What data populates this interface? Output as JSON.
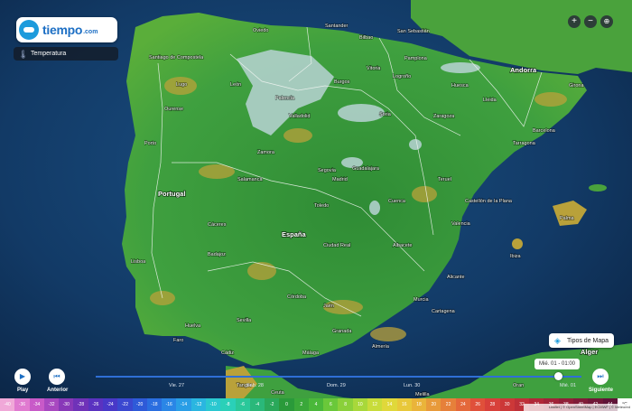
{
  "app": {
    "logo_text": "tiempo",
    "logo_domain": ".com"
  },
  "layer": {
    "label": "Temperatura",
    "icon": "thermometer-icon"
  },
  "zoom_controls": {
    "zoom_in": "+",
    "zoom_out": "−",
    "globe": "globe-icon"
  },
  "map_types": {
    "label": "Tipos de Mapa",
    "icon": "layers-icon"
  },
  "countries": {
    "portugal": "Portugal",
    "espana": "España",
    "andorra": "Andorra",
    "alger": "Alger"
  },
  "cities": [
    "Santander",
    "Bilbao",
    "San Sebastián",
    "Santiago de Compostela",
    "Oviedo",
    "Pamplona",
    "Vitoria",
    "Lugo",
    "León",
    "Burgos",
    "Logroño",
    "Huesca",
    "Lleida",
    "Girona",
    "Ourense",
    "Palencia",
    "Valladolid",
    "Soria",
    "Zaragoza",
    "Barcelona",
    "Tarragona",
    "Porto",
    "Zamora",
    "Salamanca",
    "Segovia",
    "Guadalajara",
    "Madrid",
    "Teruel",
    "Castellón de la Plana",
    "Toledo",
    "Cuenca",
    "Valencia",
    "Palma",
    "Ibiza",
    "Cáceres",
    "Ciudad Real",
    "Albacete",
    "Lisboa",
    "Badajoz",
    "Alicante",
    "Córdoba",
    "Jaén",
    "Murcia",
    "Sevilla",
    "Huelva",
    "Granada",
    "Cartagena",
    "Málaga",
    "Almería",
    "Faro",
    "Cádiz",
    "Tanger",
    "Melilla",
    "Ceuta",
    "Oran"
  ],
  "timeline": {
    "play_label": "Play",
    "prev_label": "Anterior",
    "next_label": "Siguiente",
    "current_time": "Mié. 01 - 01:00",
    "days": [
      "Vie. 27",
      "Sáb. 28",
      "Dom. 29",
      "Lun. 30",
      "Mié. 01"
    ]
  },
  "scale": {
    "unit": "°C",
    "values": [
      "-40",
      "-36",
      "-34",
      "-32",
      "-30",
      "-28",
      "-26",
      "-24",
      "-22",
      "-20",
      "-18",
      "-16",
      "-14",
      "-12",
      "-10",
      "-8",
      "-6",
      "-4",
      "-2",
      "0",
      "2",
      "4",
      "6",
      "8",
      "10",
      "12",
      "14",
      "16",
      "18",
      "20",
      "22",
      "24",
      "26",
      "28",
      "30",
      "32",
      "34",
      "36",
      "38",
      "40",
      "42",
      "44",
      "°C"
    ]
  },
  "attribution": "Leaflet | © OpenStreetMap | ECMWF | © Meteored",
  "colors": {
    "accent": "#1d9bdc",
    "timeline": "#2f6fd6",
    "land_green": "#3e9c3c",
    "sea": "#123a66"
  }
}
